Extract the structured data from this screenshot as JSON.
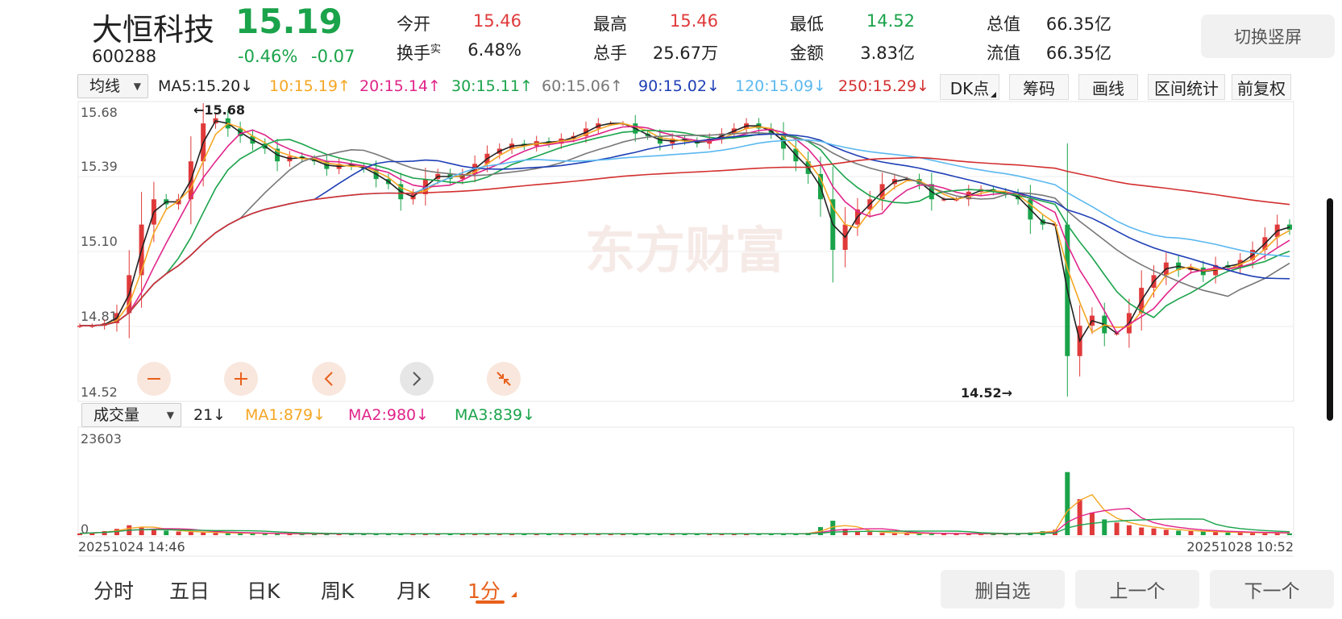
{
  "stock": {
    "name": "大恒科技",
    "price": "15.19",
    "code": "600288",
    "change_pct": "-0.46%",
    "change": "-0.07"
  },
  "stats": [
    {
      "label": "今开",
      "value": "15.46",
      "color": "#e03a3a"
    },
    {
      "label": "最高",
      "value": "15.46",
      "color": "#e03a3a"
    },
    {
      "label": "最低",
      "value": "14.52",
      "color": "#1aa34a"
    },
    {
      "label": "总值",
      "value": "66.35亿",
      "color": "#222222"
    },
    {
      "label": "换手",
      "label_sup": "实",
      "value": "6.48%",
      "color": "#222222"
    },
    {
      "label": "总手",
      "value": "25.67万",
      "color": "#222222"
    },
    {
      "label": "金额",
      "value": "3.83亿",
      "color": "#222222"
    },
    {
      "label": "流值",
      "value": "66.35亿",
      "color": "#222222"
    }
  ],
  "switch_label": "切换竖屏",
  "indicator": {
    "select": "均线",
    "mas": [
      {
        "text": "MA5:15.20↓",
        "color": "#222222"
      },
      {
        "text": "10:15.19↑",
        "color": "#f5a623"
      },
      {
        "text": "20:15.14↑",
        "color": "#e0248a"
      },
      {
        "text": "30:15.11↑",
        "color": "#1aa34a"
      },
      {
        "text": "60:15.06↑",
        "color": "#777777"
      },
      {
        "text": "90:15.02↓",
        "color": "#1f3fb5"
      },
      {
        "text": "120:15.09↓",
        "color": "#5bb8f0"
      },
      {
        "text": "250:15.29↓",
        "color": "#d32f2f"
      }
    ],
    "tools": [
      "DK点",
      "筹码",
      "画线",
      "区间统计",
      "前复权"
    ]
  },
  "price_axis": {
    "ticks": [
      "15.68",
      "15.39",
      "15.10",
      "14.81",
      "14.52"
    ],
    "high_label": "←15.68",
    "low_label": "14.52→"
  },
  "watermark": "东方财富",
  "volume": {
    "select": "成交量",
    "current": "21↓",
    "mas": [
      {
        "text": "MA1:879↓",
        "color": "#f5a623"
      },
      {
        "text": "MA2:980↓",
        "color": "#e0248a"
      },
      {
        "text": "MA3:839↓",
        "color": "#1aa34a"
      }
    ],
    "max": "23603",
    "zero": "0"
  },
  "time_axis": {
    "start": "20251024 14:46",
    "end": "20251028 10:52"
  },
  "zoom_controls": [
    "minus-icon",
    "plus-icon",
    "chevron-left-icon",
    "chevron-right-icon",
    "shrink-icon"
  ],
  "tabs": [
    {
      "label": "分时",
      "active": false
    },
    {
      "label": "五日",
      "active": false
    },
    {
      "label": "日K",
      "active": false
    },
    {
      "label": "周K",
      "active": false
    },
    {
      "label": "月K",
      "active": false
    },
    {
      "label": "1分",
      "active": true
    }
  ],
  "buttons": {
    "delete": "删自选",
    "prev": "上一个",
    "next": "下一个"
  },
  "colors": {
    "up": "#e03a3a",
    "down": "#1aa34a",
    "accent": "#e8601c"
  },
  "chart_data": {
    "type": "candlestick",
    "timeframe": "1分",
    "y_range": [
      14.52,
      15.68
    ],
    "volume_range": [
      0,
      23603
    ],
    "x_range": [
      "20251024 14:46",
      "20251028 10:52"
    ],
    "high": 15.68,
    "low": 14.52,
    "close_series": [
      14.8,
      14.8,
      14.81,
      14.85,
      15.0,
      15.2,
      15.3,
      15.28,
      15.3,
      15.45,
      15.6,
      15.62,
      15.58,
      15.55,
      15.52,
      15.5,
      15.45,
      15.47,
      15.46,
      15.45,
      15.42,
      15.44,
      15.43,
      15.42,
      15.38,
      15.36,
      15.3,
      15.32,
      15.38,
      15.4,
      15.38,
      15.4,
      15.44,
      15.48,
      15.5,
      15.52,
      15.51,
      15.53,
      15.52,
      15.54,
      15.55,
      15.58,
      15.6,
      15.6,
      15.6,
      15.56,
      15.55,
      15.52,
      15.54,
      15.53,
      15.52,
      15.54,
      15.56,
      15.58,
      15.6,
      15.58,
      15.56,
      15.5,
      15.45,
      15.4,
      15.3,
      15.1,
      15.2,
      15.26,
      15.3,
      15.36,
      15.38,
      15.38,
      15.36,
      15.3,
      15.3,
      15.3,
      15.33,
      15.34,
      15.33,
      15.32,
      15.3,
      15.22,
      15.2,
      15.2,
      14.68,
      14.8,
      14.84,
      14.77,
      14.77,
      14.85,
      14.95,
      15.0,
      15.05,
      15.02,
      15.03,
      15.0,
      15.04,
      15.03,
      15.06,
      15.1,
      15.15,
      15.2,
      15.18
    ],
    "volume_series": [
      400,
      600,
      900,
      1400,
      2200,
      1800,
      1300,
      1000,
      800,
      700,
      600,
      500,
      500,
      400,
      400,
      400,
      300,
      300,
      300,
      300,
      300,
      300,
      300,
      300,
      300,
      300,
      300,
      300,
      300,
      300,
      300,
      300,
      300,
      300,
      300,
      300,
      300,
      300,
      300,
      300,
      300,
      300,
      300,
      300,
      300,
      300,
      300,
      300,
      300,
      300,
      300,
      300,
      300,
      300,
      300,
      300,
      300,
      300,
      300,
      500,
      1800,
      3200,
      1400,
      900,
      700,
      500,
      400,
      400,
      400,
      400,
      400,
      300,
      300,
      300,
      300,
      300,
      400,
      600,
      900,
      1200,
      14000,
      8000,
      5000,
      3500,
      2800,
      2200,
      1700,
      1500,
      1200,
      1000,
      900,
      800,
      700,
      600,
      600,
      500,
      500,
      500,
      400
    ]
  }
}
